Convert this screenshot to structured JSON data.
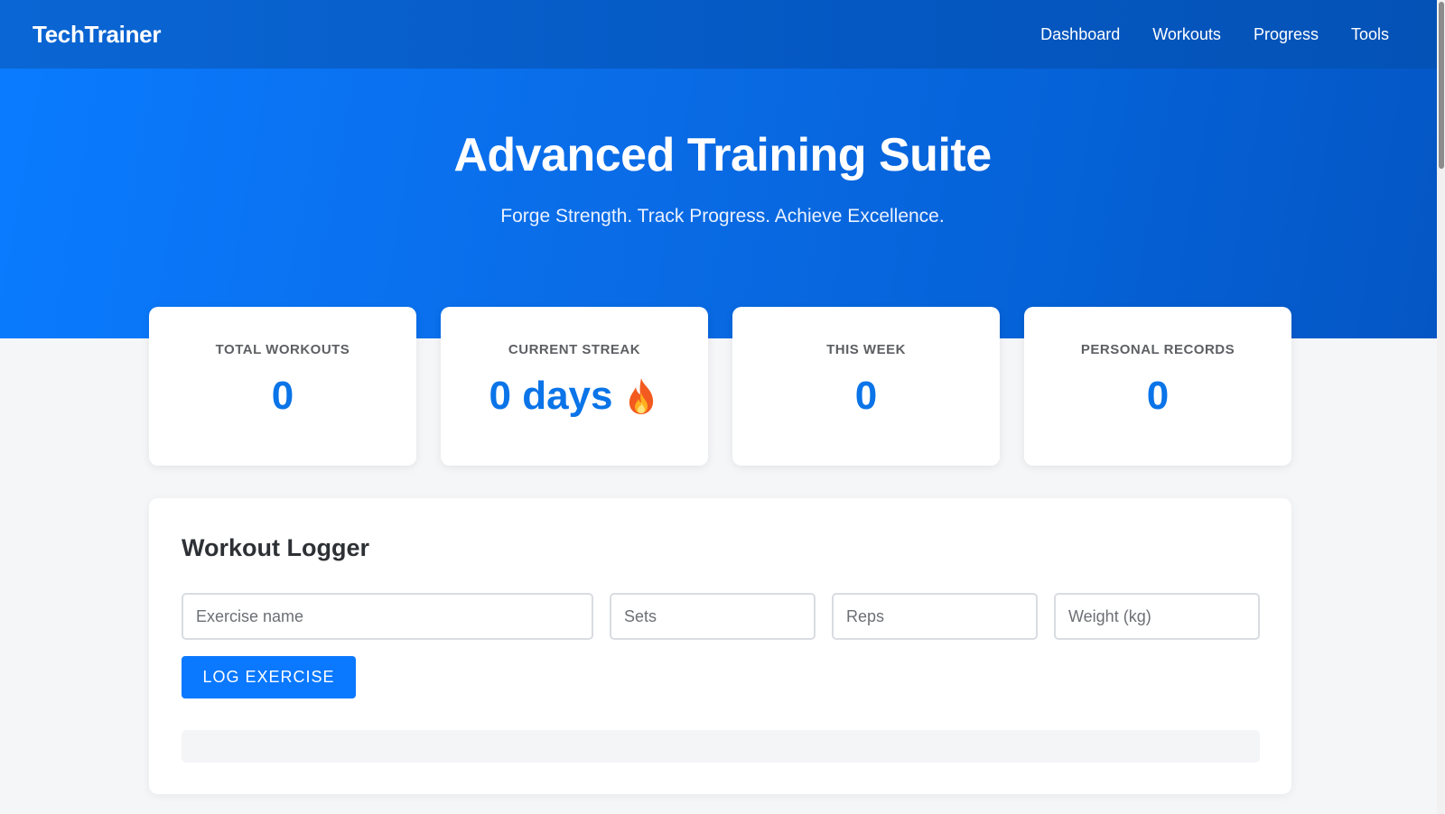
{
  "nav": {
    "brand": "TechTrainer",
    "links": [
      "Dashboard",
      "Workouts",
      "Progress",
      "Tools"
    ]
  },
  "hero": {
    "title": "Advanced Training Suite",
    "subtitle": "Forge Strength. Track Progress. Achieve Excellence."
  },
  "stats": [
    {
      "label": "TOTAL WORKOUTS",
      "value": "0"
    },
    {
      "label": "CURRENT STREAK",
      "value": "0 days",
      "icon": "fire-icon"
    },
    {
      "label": "THIS WEEK",
      "value": "0"
    },
    {
      "label": "PERSONAL RECORDS",
      "value": "0"
    }
  ],
  "logger": {
    "title": "Workout Logger",
    "exercise_placeholder": "Exercise name",
    "exercise_value": "",
    "sets_placeholder": "Sets",
    "sets_value": "",
    "reps_placeholder": "Reps",
    "reps_value": "",
    "weight_placeholder": "Weight (kg)",
    "weight_value": "",
    "button_label": "LOG EXERCISE"
  },
  "colors": {
    "primary": "#0a78ff",
    "accent_text": "#0a74e8",
    "navbar": "#0558c2",
    "background": "#f5f6f8"
  }
}
